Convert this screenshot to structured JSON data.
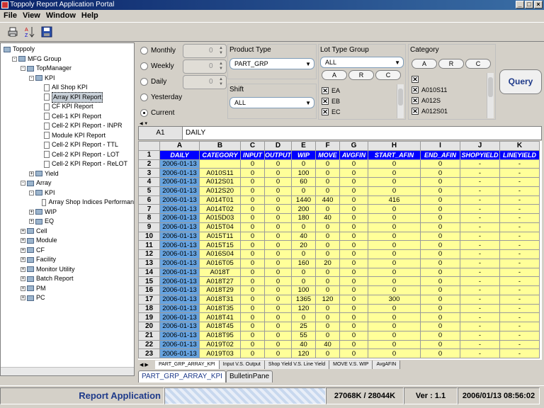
{
  "window": {
    "title": "Toppoly Report Application Portal"
  },
  "menu": [
    "File",
    "View",
    "Window",
    "Help"
  ],
  "tree": [
    {
      "label": "Toppoly",
      "level": 0,
      "type": "root"
    },
    {
      "label": "MFG Group",
      "level": 1,
      "type": "folder",
      "exp": "-"
    },
    {
      "label": "TopManager",
      "level": 2,
      "type": "folder",
      "exp": "-"
    },
    {
      "label": "KPI",
      "level": 3,
      "type": "folder",
      "exp": "-"
    },
    {
      "label": "All Shop KPI",
      "level": 4,
      "type": "doc"
    },
    {
      "label": "Array KPI Report",
      "level": 4,
      "type": "doc",
      "selected": true
    },
    {
      "label": "CF KPI Report",
      "level": 4,
      "type": "doc"
    },
    {
      "label": "Cell-1 KPI Report",
      "level": 4,
      "type": "doc"
    },
    {
      "label": "Cell-2 KPI Report - INPR",
      "level": 4,
      "type": "doc"
    },
    {
      "label": "Module KPI Report",
      "level": 4,
      "type": "doc"
    },
    {
      "label": "Cell-2 KPI Report - TTL",
      "level": 4,
      "type": "doc"
    },
    {
      "label": "Cell-2 KPI Report - LOT",
      "level": 4,
      "type": "doc"
    },
    {
      "label": "Cell-2 KPI Report - ReLOT",
      "level": 4,
      "type": "doc"
    },
    {
      "label": "Yield",
      "level": 3,
      "type": "folder",
      "exp": "+"
    },
    {
      "label": "Array",
      "level": 2,
      "type": "folder",
      "exp": "-"
    },
    {
      "label": "KPI",
      "level": 3,
      "type": "folder",
      "exp": "-"
    },
    {
      "label": "Array Shop Indices Performan",
      "level": 4,
      "type": "doc"
    },
    {
      "label": "WIP",
      "level": 3,
      "type": "folder",
      "exp": "+"
    },
    {
      "label": "EQ",
      "level": 3,
      "type": "folder",
      "exp": "+"
    },
    {
      "label": "Cell",
      "level": 2,
      "type": "folder",
      "exp": "+"
    },
    {
      "label": "Module",
      "level": 2,
      "type": "folder",
      "exp": "+"
    },
    {
      "label": "CF",
      "level": 2,
      "type": "folder",
      "exp": "+"
    },
    {
      "label": "Facility",
      "level": 2,
      "type": "folder",
      "exp": "+"
    },
    {
      "label": "Monitor Utility",
      "level": 2,
      "type": "folder",
      "exp": "+"
    },
    {
      "label": "Batch Report",
      "level": 2,
      "type": "folder",
      "exp": "+"
    },
    {
      "label": "PM",
      "level": 2,
      "type": "folder",
      "exp": "+"
    },
    {
      "label": "PC",
      "level": 2,
      "type": "folder",
      "exp": "+"
    }
  ],
  "period": {
    "monthly": "Monthly",
    "weekly": "Weekly",
    "daily": "Daily",
    "yesterday": "Yesterday",
    "current": "Current",
    "selected": "current",
    "spin_values": [
      "0",
      "0",
      "0"
    ]
  },
  "product_type": {
    "label": "Product Type",
    "value": "PART_GRP"
  },
  "shift": {
    "label": "Shift",
    "value": "ALL"
  },
  "lot_type": {
    "label": "Lot Type Group",
    "value": "ALL",
    "buttons": [
      "A",
      "R",
      "C"
    ],
    "items": [
      "EA",
      "EB",
      "EC"
    ]
  },
  "category": {
    "label": "Category",
    "buttons": [
      "A",
      "R",
      "C"
    ],
    "items": [
      "",
      "A010S11",
      "A012S",
      "A012S01"
    ]
  },
  "query_label": "Query",
  "formula": {
    "cell": "A1",
    "value": "DAILY"
  },
  "sheet": {
    "columns": [
      "A",
      "B",
      "C",
      "D",
      "E",
      "F",
      "G",
      "H",
      "I",
      "J",
      "K"
    ],
    "headers": [
      "DAILY",
      "CATEGORY",
      "INPUT",
      "OUTPUT",
      "WIP",
      "MOVE",
      "AVGFIN",
      "START_AFIN",
      "END_AFIN",
      "SHOPYIELD",
      "LINEYIELD"
    ],
    "rows": [
      [
        "2006-01-13",
        "",
        "0",
        "0",
        "0",
        "0",
        "0",
        "0",
        "0",
        "-",
        "-"
      ],
      [
        "2006-01-13",
        "A010S11",
        "0",
        "0",
        "100",
        "0",
        "0",
        "0",
        "0",
        "-",
        "-"
      ],
      [
        "2006-01-13",
        "A012S01",
        "0",
        "0",
        "60",
        "0",
        "0",
        "0",
        "0",
        "-",
        "-"
      ],
      [
        "2006-01-13",
        "A012S20",
        "0",
        "0",
        "0",
        "0",
        "0",
        "0",
        "0",
        "-",
        "-"
      ],
      [
        "2006-01-13",
        "A014T01",
        "0",
        "0",
        "1440",
        "440",
        "0",
        "416",
        "0",
        "-",
        "-"
      ],
      [
        "2006-01-13",
        "A014T02",
        "0",
        "0",
        "200",
        "0",
        "0",
        "0",
        "0",
        "-",
        "-"
      ],
      [
        "2006-01-13",
        "A015D03",
        "0",
        "0",
        "180",
        "40",
        "0",
        "0",
        "0",
        "-",
        "-"
      ],
      [
        "2006-01-13",
        "A015T04",
        "0",
        "0",
        "0",
        "0",
        "0",
        "0",
        "0",
        "-",
        "-"
      ],
      [
        "2006-01-13",
        "A015T11",
        "0",
        "0",
        "40",
        "0",
        "0",
        "0",
        "0",
        "-",
        "-"
      ],
      [
        "2006-01-13",
        "A015T15",
        "0",
        "0",
        "20",
        "0",
        "0",
        "0",
        "0",
        "-",
        "-"
      ],
      [
        "2006-01-13",
        "A016S04",
        "0",
        "0",
        "0",
        "0",
        "0",
        "0",
        "0",
        "-",
        "-"
      ],
      [
        "2006-01-13",
        "A016T05",
        "0",
        "0",
        "160",
        "20",
        "0",
        "0",
        "0",
        "-",
        "-"
      ],
      [
        "2006-01-13",
        "A018T",
        "0",
        "0",
        "0",
        "0",
        "0",
        "0",
        "0",
        "-",
        "-"
      ],
      [
        "2006-01-13",
        "A018T27",
        "0",
        "0",
        "0",
        "0",
        "0",
        "0",
        "0",
        "-",
        "-"
      ],
      [
        "2006-01-13",
        "A018T29",
        "0",
        "0",
        "100",
        "0",
        "0",
        "0",
        "0",
        "-",
        "-"
      ],
      [
        "2006-01-13",
        "A018T31",
        "0",
        "0",
        "1365",
        "120",
        "0",
        "300",
        "0",
        "-",
        "-"
      ],
      [
        "2006-01-13",
        "A018T35",
        "0",
        "0",
        "120",
        "0",
        "0",
        "0",
        "0",
        "-",
        "-"
      ],
      [
        "2006-01-13",
        "A018T41",
        "0",
        "0",
        "0",
        "0",
        "0",
        "0",
        "0",
        "-",
        "-"
      ],
      [
        "2006-01-13",
        "A018T45",
        "0",
        "0",
        "25",
        "0",
        "0",
        "0",
        "0",
        "-",
        "-"
      ],
      [
        "2006-01-13",
        "A018T95",
        "0",
        "0",
        "55",
        "0",
        "0",
        "0",
        "0",
        "-",
        "-"
      ],
      [
        "2006-01-13",
        "A019T02",
        "0",
        "0",
        "40",
        "40",
        "0",
        "0",
        "0",
        "-",
        "-"
      ],
      [
        "2006-01-13",
        "A019T03",
        "0",
        "0",
        "120",
        "0",
        "0",
        "0",
        "0",
        "-",
        "-"
      ]
    ]
  },
  "sheet_tabs": [
    "PART_GRP_ARRAY_KPI",
    "Input V.S. Output",
    "Shop Yield V.S. Line Yield",
    "MOVE V.S. WIP",
    "AvgAFIN"
  ],
  "pane_tabs": [
    "PART_GRP_ARRAY_KPI",
    "BulletinPane"
  ],
  "status": {
    "app": "Report Application",
    "memory": "27068K / 28044K",
    "version": "Ver : 1.1",
    "datetime": "2006/01/13 08:56:02"
  }
}
